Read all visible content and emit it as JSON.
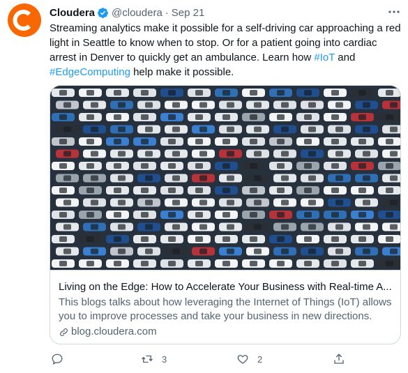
{
  "tweet": {
    "author_name": "Cloudera",
    "handle": "@cloudera",
    "separator": "·",
    "date": "Sep 21",
    "text_part1": "Streaming analytics make it possible for a self-driving car approaching a red light in Seattle to know when to stop. Or for a patient going into cardiac arrest in Denver to quickly get an ambulance. Learn how ",
    "hashtag1": "#IoT",
    "text_part2": " and ",
    "hashtag2": "#EdgeComputing",
    "text_part3": " help make it possible."
  },
  "card": {
    "image_alt": "Aerial view of parked cars",
    "title": "Living on the Edge: How to Accelerate Your Business with Real-time A...",
    "description": "This blogs talks about how leveraging the Internet of Things (IoT) allows you to improve processes and take your business in new directions.",
    "domain": "blog.cloudera.com"
  },
  "actions": {
    "reply_count": "",
    "retweet_count": "3",
    "like_count": "2"
  },
  "colors": {
    "brand": "#f96702",
    "link": "#1d9bf0",
    "muted": "#536471",
    "border": "#cfd9de"
  },
  "icons": [
    "cloudera-logo-icon",
    "verified-badge-icon",
    "more-icon",
    "link-icon",
    "reply-icon",
    "retweet-icon",
    "like-icon",
    "share-icon"
  ]
}
